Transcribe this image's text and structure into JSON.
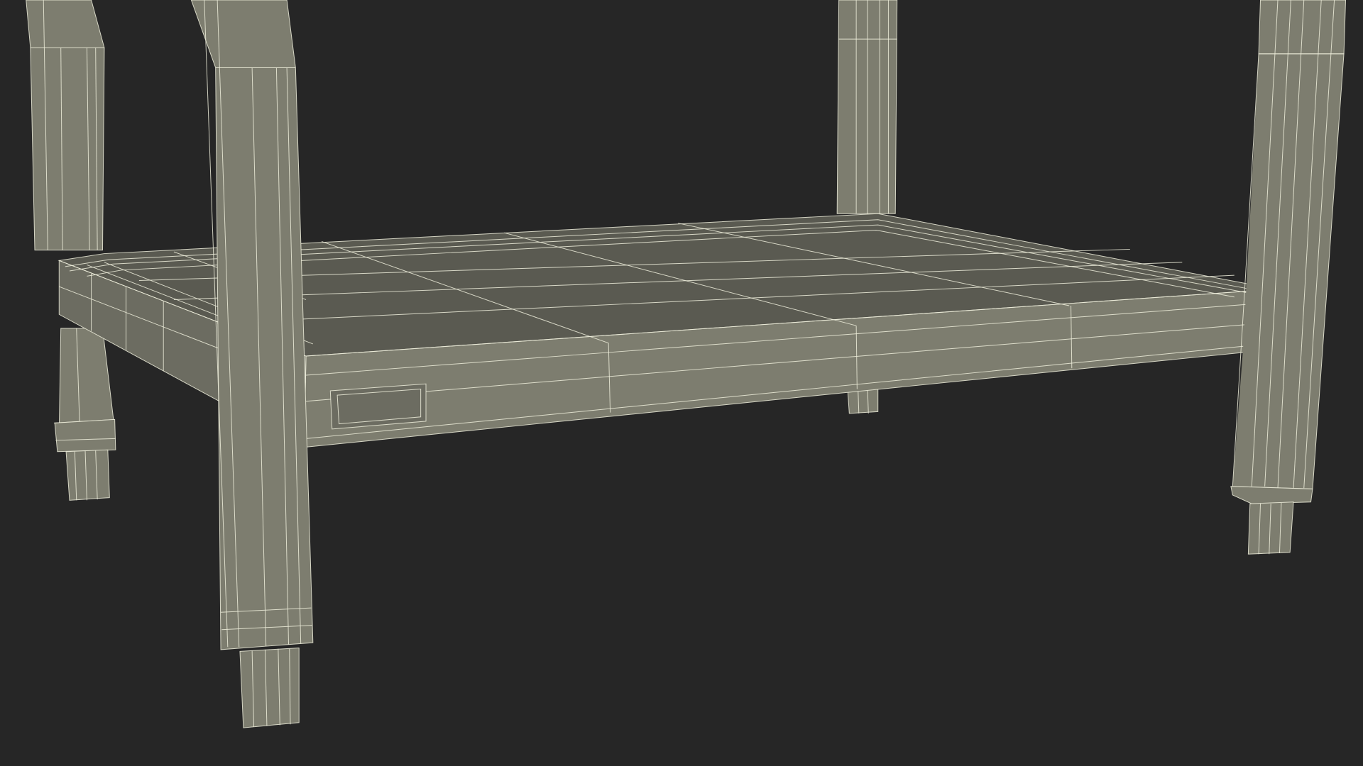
{
  "scene": {
    "subject": "",
    "background_color": "#262626",
    "surface_color": "#7d7d6f",
    "surface_dark_color": "#5a5a51",
    "surface_shade_color": "#6c6c61",
    "wire_color": "#efefdc"
  }
}
